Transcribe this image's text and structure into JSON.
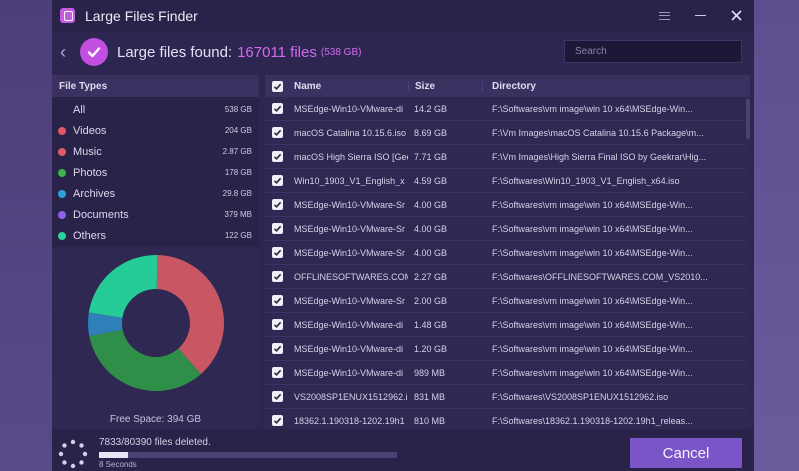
{
  "app": {
    "title": "Large Files Finder"
  },
  "header": {
    "found_label": "Large files found:",
    "found_count": "167011 files",
    "found_size": "(538 GB)",
    "search_placeholder": "Search"
  },
  "file_types": {
    "header": "File Types",
    "items": [
      {
        "name": "All",
        "size": "538 GB",
        "color": ""
      },
      {
        "name": "Videos",
        "size": "204 GB",
        "color": "#e0586a"
      },
      {
        "name": "Music",
        "size": "2.87 GB",
        "color": "#e05a63"
      },
      {
        "name": "Photos",
        "size": "178 GB",
        "color": "#3fb24d"
      },
      {
        "name": "Archives",
        "size": "29.8 GB",
        "color": "#2aa3d8"
      },
      {
        "name": "Documents",
        "size": "379 MB",
        "color": "#8b62e8"
      },
      {
        "name": "Others",
        "size": "122 GB",
        "color": "#2ad29a"
      }
    ],
    "free_space": "Free Space: 394 GB"
  },
  "donut": {
    "segments": [
      {
        "label": "Videos",
        "value": 204,
        "color": "#c95763"
      },
      {
        "label": "Photos",
        "value": 178,
        "color": "#2f8f49"
      },
      {
        "label": "Archives",
        "value": 29.8,
        "color": "#2f7fb8"
      },
      {
        "label": "Others",
        "value": 122,
        "color": "#26cc97"
      }
    ]
  },
  "table": {
    "columns": {
      "name": "Name",
      "size": "Size",
      "directory": "Directory"
    },
    "rows": [
      {
        "name": "MSEdge-Win10-VMware-di",
        "size": "14.2 GB",
        "dir": "F:\\Softwares\\vm image\\win 10 x64\\MSEdge-Win..."
      },
      {
        "name": "macOS Catalina 10.15.6.iso",
        "size": "8.69 GB",
        "dir": "F:\\Vm Images\\macOS Catalina 10.15.6 Package\\m..."
      },
      {
        "name": "macOS High Sierra ISO [Geek",
        "size": "7.71 GB",
        "dir": "F:\\Vm Images\\High Sierra Final ISO by Geekrar\\Hig..."
      },
      {
        "name": "Win10_1903_V1_English_x",
        "size": "4.59 GB",
        "dir": "F:\\Softwares\\Win10_1903_V1_English_x64.iso"
      },
      {
        "name": "MSEdge-Win10-VMware-Sr",
        "size": "4.00 GB",
        "dir": "F:\\Softwares\\vm image\\win 10 x64\\MSEdge-Win..."
      },
      {
        "name": "MSEdge-Win10-VMware-Sr",
        "size": "4.00 GB",
        "dir": "F:\\Softwares\\vm image\\win 10 x64\\MSEdge-Win..."
      },
      {
        "name": "MSEdge-Win10-VMware-Sr",
        "size": "4.00 GB",
        "dir": "F:\\Softwares\\vm image\\win 10 x64\\MSEdge-Win..."
      },
      {
        "name": "OFFLINESOFTWARES.COM_",
        "size": "2.27 GB",
        "dir": "F:\\Softwares\\OFFLINESOFTWARES.COM_VS2010..."
      },
      {
        "name": "MSEdge-Win10-VMware-Sr",
        "size": "2.00 GB",
        "dir": "F:\\Softwares\\vm image\\win 10 x64\\MSEdge-Win..."
      },
      {
        "name": "MSEdge-Win10-VMware-di",
        "size": "1.48 GB",
        "dir": "F:\\Softwares\\vm image\\win 10 x64\\MSEdge-Win..."
      },
      {
        "name": "MSEdge-Win10-VMware-di",
        "size": "1.20 GB",
        "dir": "F:\\Softwares\\vm image\\win 10 x64\\MSEdge-Win..."
      },
      {
        "name": "MSEdge-Win10-VMware-di",
        "size": "989 MB",
        "dir": "F:\\Softwares\\vm image\\win 10 x64\\MSEdge-Win..."
      },
      {
        "name": "VS2008SP1ENUX1512962.i",
        "size": "831 MB",
        "dir": "F:\\Softwares\\VS2008SP1ENUX1512962.iso"
      },
      {
        "name": "18362.1.190318-1202.19h1",
        "size": "810 MB",
        "dir": "F:\\Softwares\\18362.1.190318-1202.19h1_releas..."
      }
    ]
  },
  "footer": {
    "deleted_text": "7833/80390 files deleted.",
    "seconds": "8 Seconds",
    "progress_fraction": 0.0974,
    "cancel_label": "Cancel"
  }
}
